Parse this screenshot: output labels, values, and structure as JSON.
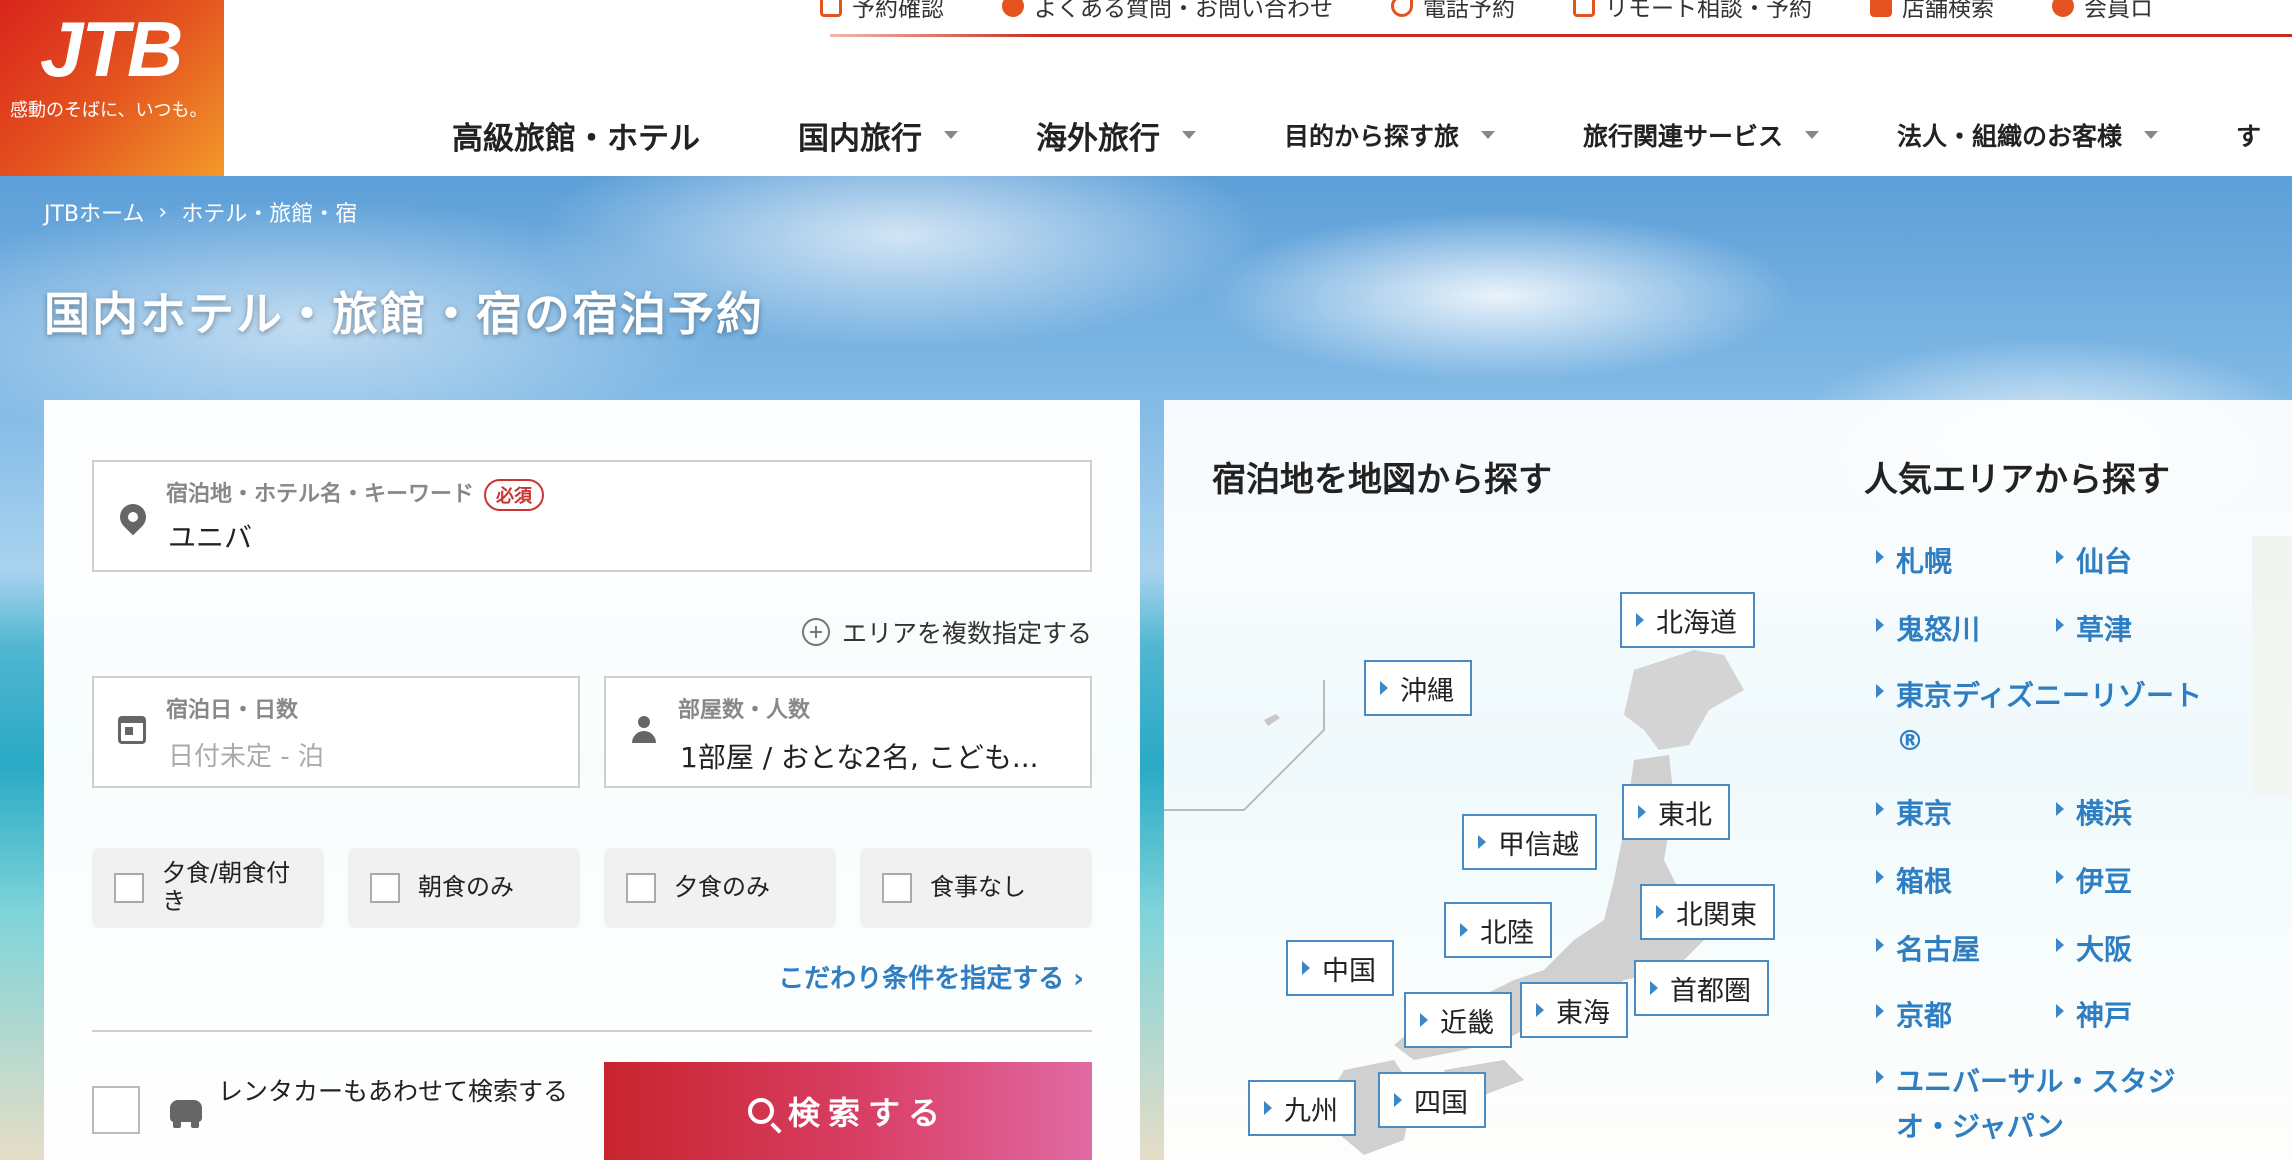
{
  "logo": {
    "mark": "JTB",
    "tagline": "感動のそばに、いつも。"
  },
  "utility_nav": [
    {
      "label": "予約確認",
      "color": "#e4531f"
    },
    {
      "label": "よくある質問・お問い合わせ",
      "color": "#e4531f"
    },
    {
      "label": "電話予約",
      "color": "#e4531f"
    },
    {
      "label": "リモート相談・予約",
      "color": "#e4531f"
    },
    {
      "label": "店舗検索",
      "color": "#e4531f"
    },
    {
      "label": "会員ロ",
      "color": "#e4531f"
    }
  ],
  "global_nav": [
    {
      "label": "高級旅館・ホテル",
      "dropdown": false
    },
    {
      "label": "国内旅行",
      "dropdown": true
    },
    {
      "label": "海外旅行",
      "dropdown": true
    },
    {
      "label": "目的から探す旅",
      "dropdown": true
    },
    {
      "label": "旅行関連サービス",
      "dropdown": true
    },
    {
      "label": "法人・組織のお客様",
      "dropdown": true
    },
    {
      "label": "す",
      "dropdown": false
    }
  ],
  "breadcrumb": {
    "home": "JTBホーム",
    "separator": "›",
    "current": "ホテル・旅館・宿"
  },
  "page_title": "国内ホテル・旅館・宿の宿泊予約",
  "search": {
    "keyword": {
      "label": "宿泊地・ホテル名・キーワード",
      "required": "必須",
      "value": "ユニバ"
    },
    "add_area": "エリアを複数指定する",
    "dates": {
      "label": "宿泊日・日数",
      "placeholder": "日付未定 - 泊"
    },
    "rooms": {
      "label": "部屋数・人数",
      "value": "1部屋 / おとな2名, こども..."
    },
    "meals": [
      "夕食/朝食付き",
      "朝食のみ",
      "夕食のみ",
      "食事なし"
    ],
    "more_conditions": "こだわり条件を指定する ›",
    "rental_car": "レンタカーもあわせて検索する",
    "search_button": "検索する"
  },
  "map": {
    "title": "宿泊地を地図から探す",
    "regions": [
      "北海道",
      "沖縄",
      "東北",
      "甲信越",
      "北関東",
      "北陸",
      "中国",
      "首都圏",
      "東海",
      "近畿",
      "九州",
      "四国"
    ]
  },
  "popular": {
    "title": "人気エリアから探す",
    "items": [
      "札幌",
      "仙台",
      "鬼怒川",
      "草津",
      "東京ディズニーリゾート®",
      "東京",
      "横浜",
      "箱根",
      "伊豆",
      "名古屋",
      "大阪",
      "京都",
      "神戸",
      "ユニバーサル・スタジオ・ジャパン"
    ]
  },
  "colors": {
    "accent": "#c62d1f",
    "link": "#2f7ec1",
    "region_border": "#4a8bc1"
  }
}
